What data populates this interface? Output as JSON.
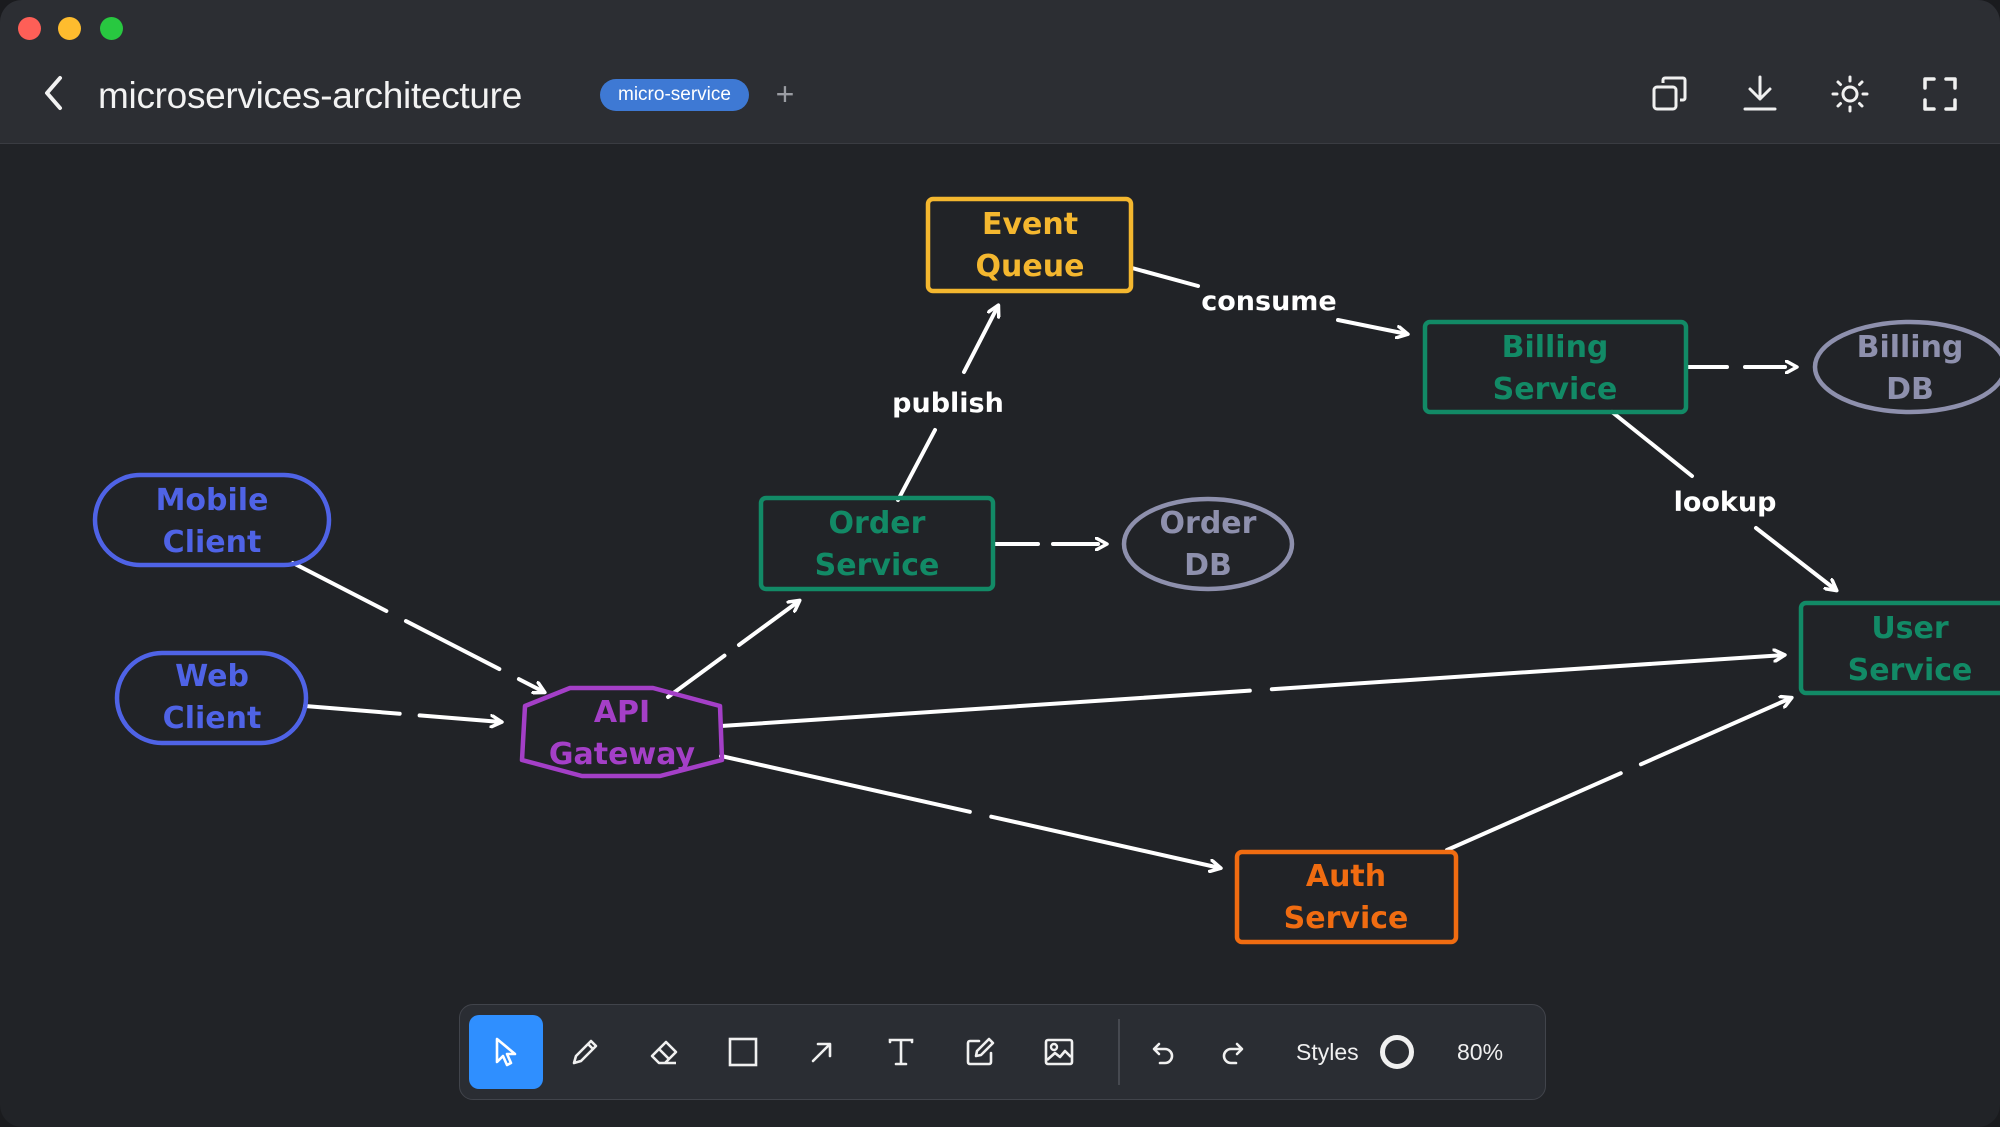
{
  "window": {
    "title": "microservices-architecture",
    "tag": "micro-service",
    "add_tag_label": "+"
  },
  "header_actions": [
    "duplicate-icon",
    "download-icon",
    "theme-sun-icon",
    "fullscreen-icon"
  ],
  "diagram": {
    "nodes": {
      "event_queue": [
        "Event",
        "Queue"
      ],
      "billing_service": [
        "Billing",
        "Service"
      ],
      "billing_db": [
        "Billing",
        "DB"
      ],
      "mobile_client": [
        "Mobile",
        "Client"
      ],
      "order_service": [
        "Order",
        "Service"
      ],
      "order_db": [
        "Order",
        "DB"
      ],
      "user_service": [
        "User",
        "Service"
      ],
      "web_client": [
        "Web",
        "Client"
      ],
      "api_gateway": [
        "API",
        "Gateway"
      ],
      "auth_service": [
        "Auth",
        "Service"
      ]
    },
    "edge_labels": {
      "consume": "consume",
      "publish": "publish",
      "lookup": "lookup"
    },
    "colors": {
      "client": "#4f63e6",
      "gateway": "#a43fc7",
      "service": "#128a66",
      "queue": "#f4b72f",
      "database": "#8e90ad",
      "auth": "#f06c11",
      "edge": "#ffffff"
    }
  },
  "toolbar": {
    "tools": [
      "select-tool",
      "pencil-tool",
      "eraser-tool",
      "rectangle-tool",
      "arrow-tool",
      "text-tool",
      "note-tool",
      "image-tool"
    ],
    "active_tool": "select-tool",
    "styles_label": "Styles",
    "zoom": "80%"
  }
}
